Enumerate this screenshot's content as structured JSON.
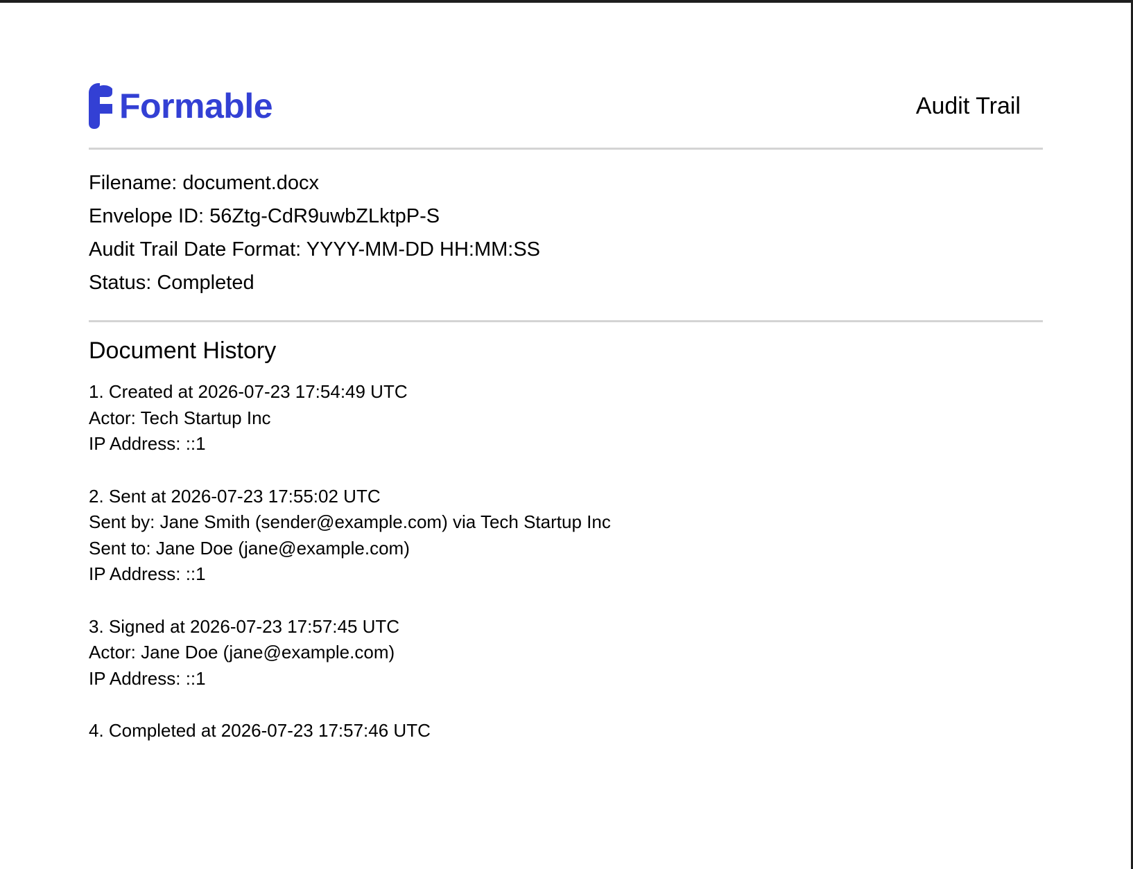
{
  "brand": {
    "name": "Formable",
    "color": "#3340d4",
    "logo_icon": "formable-logo-icon"
  },
  "header": {
    "title": "Audit Trail"
  },
  "meta": {
    "filename": "Filename: document.docx",
    "envelope_id": "Envelope ID: 56Ztg-CdR9uwbZLktpP-S",
    "date_format": "Audit Trail Date Format: YYYY-MM-DD HH:MM:SS",
    "status": "Status: Completed"
  },
  "history": {
    "title": "Document History",
    "events": [
      {
        "heading": "1. Created at 2026-07-23 17:54:49 UTC",
        "details": [
          "Actor: Tech Startup Inc",
          "IP Address: ::1"
        ]
      },
      {
        "heading": "2. Sent at 2026-07-23 17:55:02 UTC",
        "details": [
          "Sent by: Jane Smith (sender@example.com) via Tech Startup Inc",
          "Sent to: Jane Doe (jane@example.com)",
          "IP Address: ::1"
        ]
      },
      {
        "heading": "3. Signed at 2026-07-23 17:57:45 UTC",
        "details": [
          "Actor: Jane Doe (jane@example.com)",
          "IP Address: ::1"
        ]
      },
      {
        "heading": "4. Completed at 2026-07-23 17:57:46 UTC",
        "details": []
      }
    ]
  }
}
